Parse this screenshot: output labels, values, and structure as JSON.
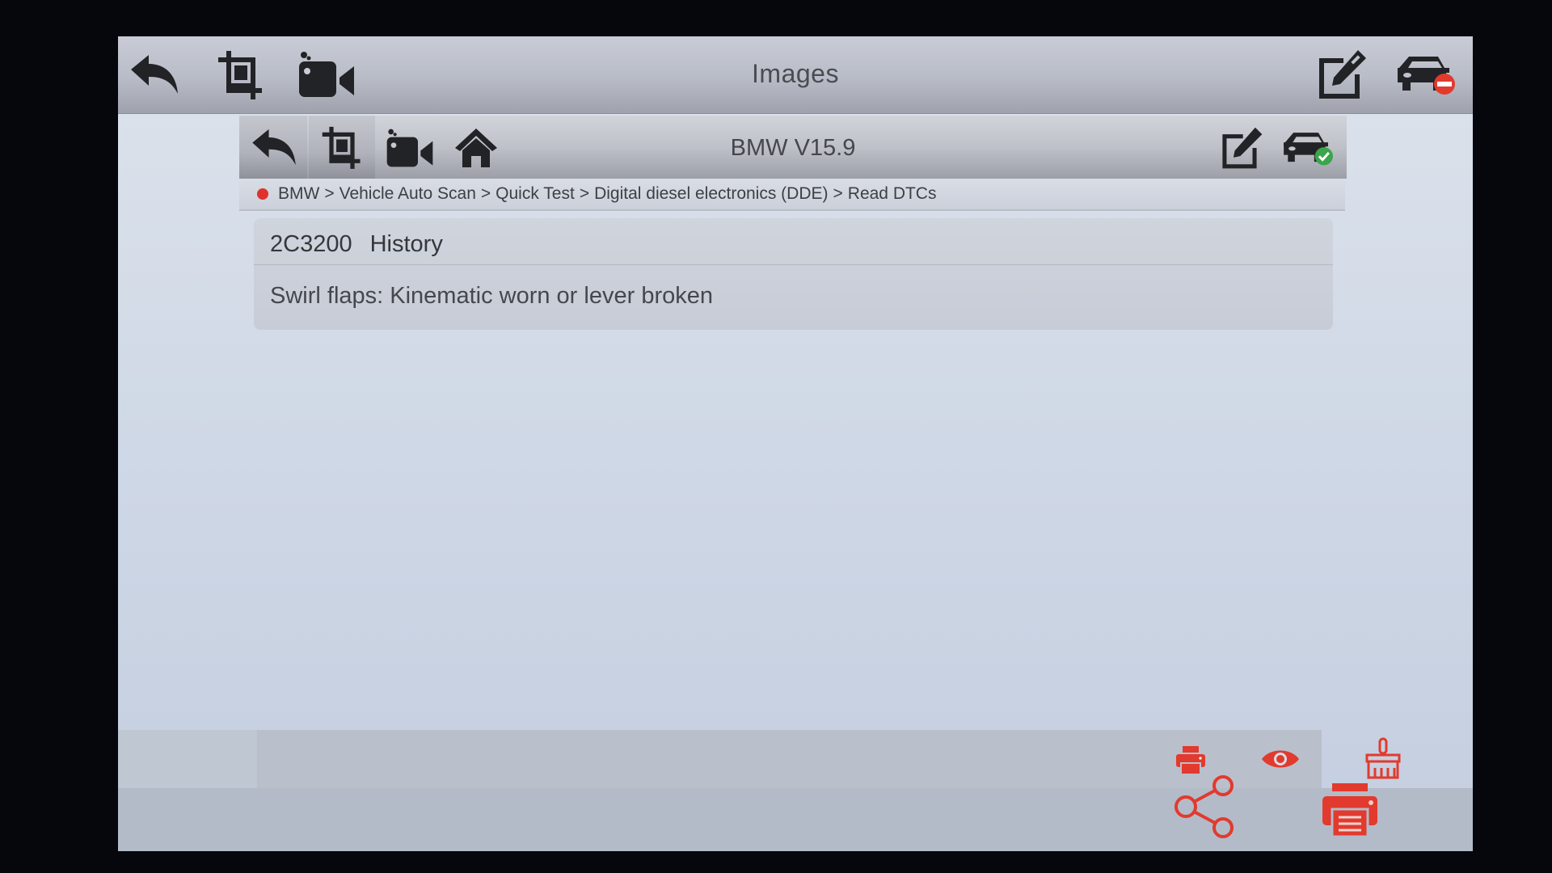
{
  "outer_window": {
    "title": "Images",
    "toolbar_left": [
      {
        "name": "back",
        "icon": "back-arrow-icon"
      },
      {
        "name": "screenshot",
        "icon": "crop-icon"
      },
      {
        "name": "record",
        "icon": "video-camera-icon"
      }
    ],
    "toolbar_right": [
      {
        "name": "notes",
        "icon": "edit-note-icon"
      },
      {
        "name": "vehicle-disconnected",
        "icon": "car-disconnected-icon",
        "status_color": "#e23a2e"
      }
    ],
    "bottom_actions": [
      {
        "name": "share",
        "icon": "share-icon"
      },
      {
        "name": "print-report",
        "icon": "printer-report-icon"
      }
    ]
  },
  "app": {
    "title": "BMW V15.9",
    "toolbar_left": [
      {
        "name": "back",
        "icon": "back-arrow-icon"
      },
      {
        "name": "screenshot",
        "icon": "crop-icon"
      },
      {
        "name": "record",
        "icon": "video-camera-icon"
      },
      {
        "name": "home",
        "icon": "home-icon"
      }
    ],
    "toolbar_right": [
      {
        "name": "notes",
        "icon": "edit-note-icon"
      },
      {
        "name": "vehicle-connected",
        "icon": "car-connected-icon",
        "status_color": "#3aa54a"
      }
    ],
    "breadcrumb": {
      "status_color": "#e0322c",
      "separator": ">",
      "items": [
        "BMW",
        "Vehicle Auto Scan",
        "Quick Test",
        "Digital diesel electronics (DDE)",
        "Read DTCs"
      ]
    },
    "dtcs": [
      {
        "code": "2C3200",
        "status": "History",
        "description": "Swirl flaps: Kinematic worn or lever broken"
      }
    ],
    "bottom_actions": [
      {
        "name": "print",
        "icon": "printer-icon"
      },
      {
        "name": "view",
        "icon": "eye-icon"
      },
      {
        "name": "clear",
        "icon": "brush-clear-icon"
      }
    ]
  },
  "colors": {
    "accent_red": "#e23a2e",
    "icon_dark": "#222326",
    "success_green": "#3aa54a"
  }
}
